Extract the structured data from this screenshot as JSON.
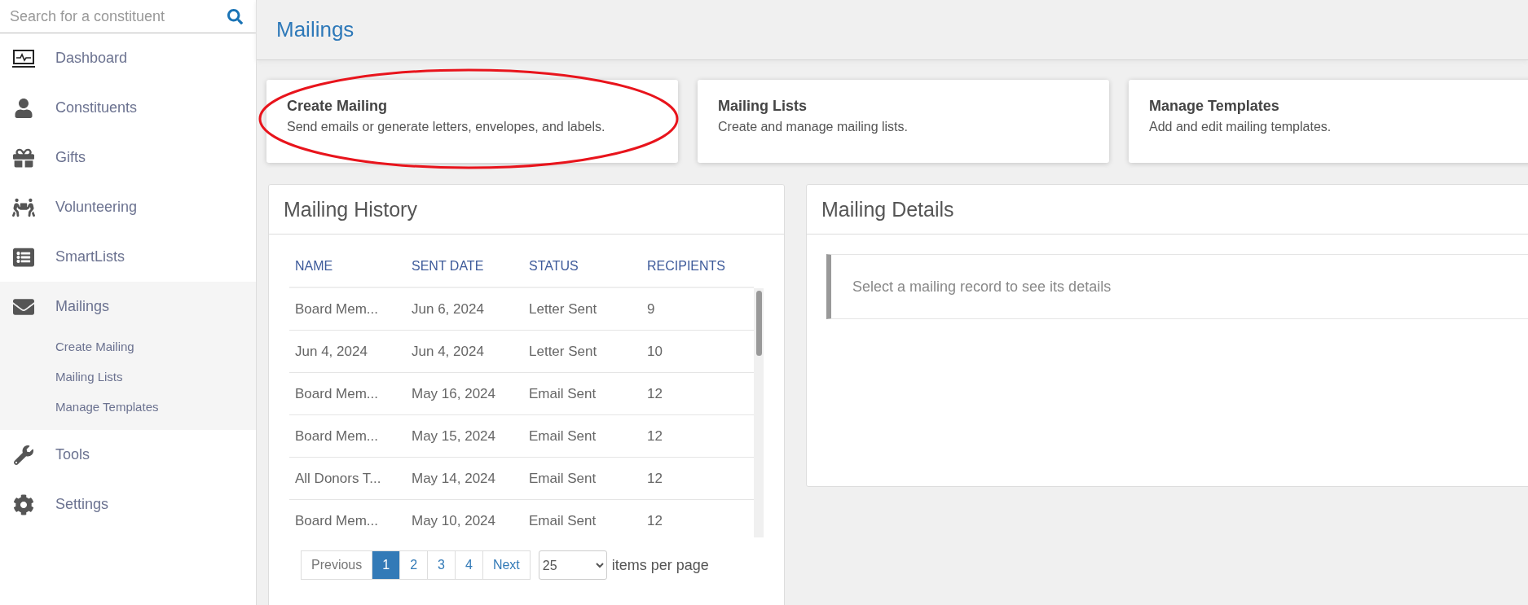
{
  "sidebar": {
    "search": {
      "placeholder": "Search for a constituent"
    },
    "items": [
      {
        "label": "Dashboard",
        "selected": false
      },
      {
        "label": "Constituents",
        "selected": false
      },
      {
        "label": "Gifts",
        "selected": false
      },
      {
        "label": "Volunteering",
        "selected": false
      },
      {
        "label": "SmartLists",
        "selected": false
      },
      {
        "label": "Mailings",
        "selected": true,
        "children": [
          {
            "label": "Create Mailing"
          },
          {
            "label": "Mailing Lists"
          },
          {
            "label": "Manage Templates"
          }
        ]
      },
      {
        "label": "Tools",
        "selected": false
      },
      {
        "label": "Settings",
        "selected": false
      }
    ]
  },
  "page": {
    "title": "Mailings"
  },
  "cards": [
    {
      "title": "Create Mailing",
      "description": "Send emails or generate letters, envelopes, and labels.",
      "highlighted": true
    },
    {
      "title": "Mailing Lists",
      "description": "Create and manage mailing lists.",
      "highlighted": false
    },
    {
      "title": "Manage Templates",
      "description": "Add and edit mailing templates.",
      "highlighted": false
    }
  ],
  "history": {
    "title": "Mailing History",
    "columns": [
      "NAME",
      "SENT DATE",
      "STATUS",
      "RECIPIENTS"
    ],
    "rows": [
      [
        "Board Mem...",
        "Jun 6, 2024",
        "Letter Sent",
        "9"
      ],
      [
        "Jun 4, 2024",
        "Jun 4, 2024",
        "Letter Sent",
        "10"
      ],
      [
        "Board Mem...",
        "May 16, 2024",
        "Email Sent",
        "12"
      ],
      [
        "Board Mem...",
        "May 15, 2024",
        "Email Sent",
        "12"
      ],
      [
        "All Donors T...",
        "May 14, 2024",
        "Email Sent",
        "12"
      ],
      [
        "Board Mem...",
        "May 10, 2024",
        "Email Sent",
        "12"
      ]
    ],
    "pagination": {
      "previous": "Previous",
      "next": "Next",
      "pages": [
        {
          "label": "1",
          "selected": true
        },
        {
          "label": "2",
          "selected": false
        },
        {
          "label": "3",
          "selected": false
        },
        {
          "label": "4",
          "selected": false
        }
      ]
    },
    "page_size": {
      "value": "25",
      "label": "items per page"
    }
  },
  "details": {
    "title": "Mailing Details",
    "message": "Select a mailing record to see its details"
  }
}
